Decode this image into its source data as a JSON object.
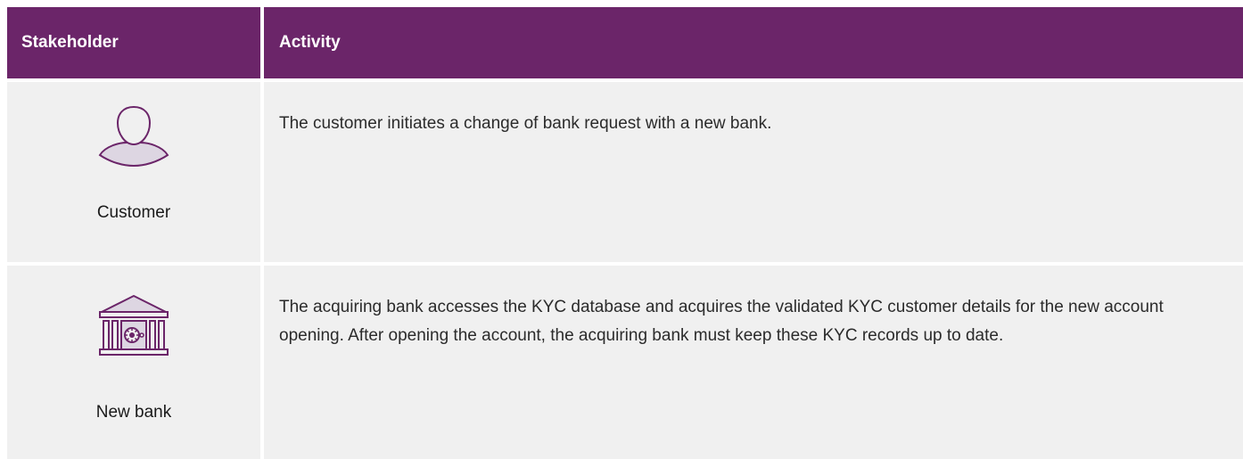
{
  "header": {
    "stakeholder": "Stakeholder",
    "activity": "Activity"
  },
  "rows": [
    {
      "stakeholder": "Customer",
      "icon": "person-icon",
      "activity": "The customer initiates a change of bank request with a new bank."
    },
    {
      "stakeholder": "New bank",
      "icon": "bank-icon",
      "activity": "The acquiring bank accesses the KYC database and acquires the validated KYC customer details for the new account opening. After opening the account, the acquiring bank must keep these KYC records up to date."
    }
  ],
  "colors": {
    "header_bg": "#6b2569",
    "row_bg": "#f0f0f0",
    "icon_stroke": "#6b2569",
    "icon_fill": "#ddd6e2"
  }
}
